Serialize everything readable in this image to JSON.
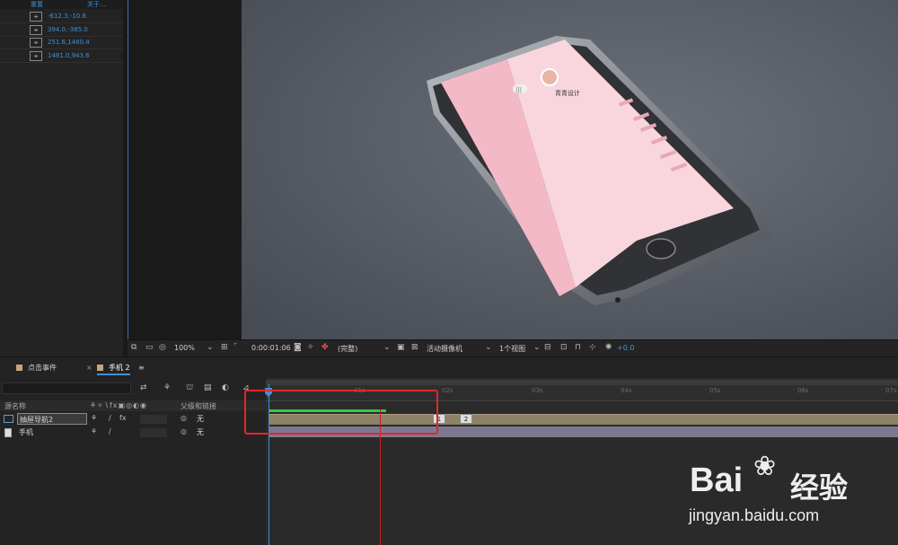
{
  "effects_panel": {
    "headers": [
      "重置",
      "关于..."
    ],
    "rows": [
      {
        "icon": "crosshair-icon",
        "value": "-612.3,-10.8"
      },
      {
        "icon": "crosshair-icon",
        "value": "394.0,-385.0"
      },
      {
        "icon": "crosshair-icon",
        "value": "251.6,1480.4"
      },
      {
        "icon": "crosshair-icon",
        "value": "1481.0,943.6"
      }
    ]
  },
  "phone_screen": {
    "profile_name": "青青设计",
    "menu_glyph": "|||"
  },
  "viewer_toolbar": {
    "zoom": "100%",
    "timecode": "0:00:01:06",
    "resolution": "(完整)",
    "camera": "活动摄像机",
    "views": "1个视图",
    "exposure": "+0.0"
  },
  "tabs": [
    {
      "label": "点击事件",
      "swatch": "#c5a77a",
      "active": false
    },
    {
      "label": "手机 2",
      "swatch": "#c5a77a",
      "active": true
    }
  ],
  "timeline": {
    "columns": {
      "source_name": "源名称",
      "parent_link": "父级和链接"
    },
    "layers": [
      {
        "name": "抽屉导航2",
        "parent": "无",
        "selected": true
      },
      {
        "name": "手机",
        "parent": "无",
        "selected": false
      }
    ],
    "ruler_ticks": [
      "01s",
      "02s",
      "03s",
      "04s",
      "05s",
      "06s",
      "07s"
    ],
    "keyframes": [
      "1",
      "2"
    ]
  },
  "watermark": {
    "brand": "Bai",
    "brand_cn": "经验",
    "url": "jingyan.baidu.com"
  },
  "colors": {
    "accent": "#3f8fd8",
    "highlight_box": "#e3262d",
    "layer_bar": "#8d8168",
    "pink": "#f4b9c6"
  }
}
